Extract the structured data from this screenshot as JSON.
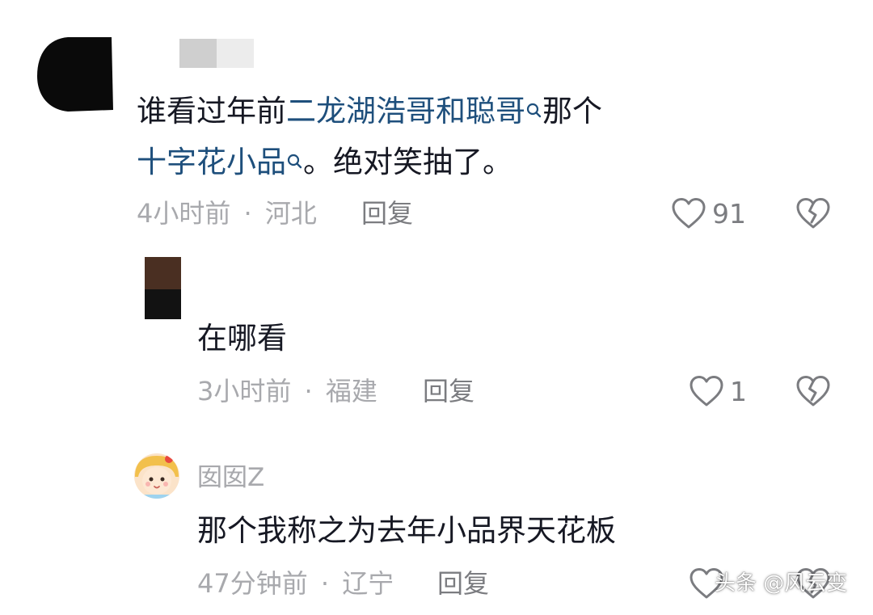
{
  "colors": {
    "keyword": "#1e4f7c",
    "text": "#161823",
    "meta": "#a8a9ad",
    "reply": "#7b7c80"
  },
  "comments": [
    {
      "text_parts": [
        "谁看过年前",
        "二龙湖浩哥和聪哥",
        "那个",
        "十字花小品",
        "。绝对笑抽了。"
      ],
      "keyword_icon": "search-icon",
      "time": "4小时前",
      "separator": "·",
      "location": "河北",
      "reply_label": "回复",
      "likes": "91",
      "like_icon": "heart-outline-icon",
      "dislike_icon": "broken-heart-icon"
    },
    {
      "text": "在哪看",
      "time": "3小时前",
      "separator": "·",
      "location": "福建",
      "reply_label": "回复",
      "likes": "1",
      "like_icon": "heart-outline-icon",
      "dislike_icon": "broken-heart-icon"
    },
    {
      "username": "囡囡Z",
      "text": "那个我称之为去年小品界天花板",
      "time": "47分钟前",
      "separator": "·",
      "location": "辽宁",
      "reply_label": "回复",
      "like_icon": "heart-outline-icon",
      "dislike_icon": "broken-heart-icon"
    }
  ],
  "watermark": "头条 @风云变"
}
